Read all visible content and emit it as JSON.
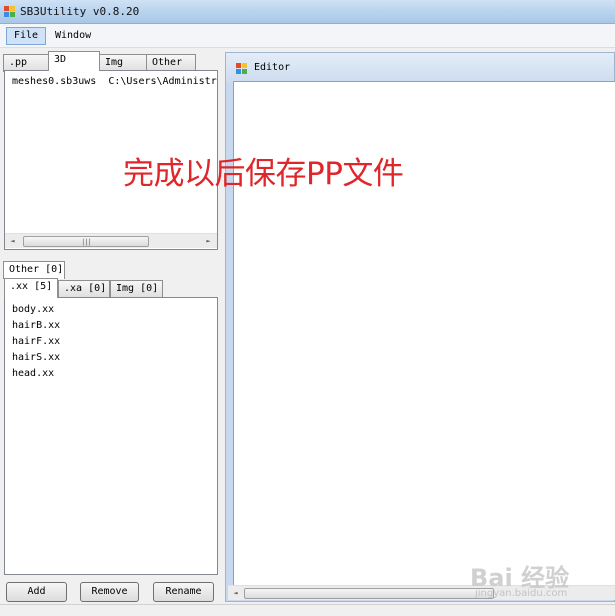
{
  "window": {
    "title": "SB3Utility v0.8.20"
  },
  "menu": {
    "file": "File",
    "window": "Window"
  },
  "top_tabs": [
    ".pp",
    "3D",
    "Img",
    "Other"
  ],
  "file_list": {
    "name": "meshes0.sb3uws",
    "path": "C:\\Users\\Administr"
  },
  "scrollbar": {
    "left_arrow": "◄",
    "right_arrow": "►",
    "grip": "|||"
  },
  "mid_tab": "Other [0]",
  "bottom_tabs": [
    ".xx [5]",
    ".xa [0]",
    "Img [0]"
  ],
  "xx_files": [
    "body.xx",
    "hairB.xx",
    "hairF.xx",
    "hairS.xx",
    "head.xx"
  ],
  "buttons": {
    "add": "Add",
    "remove": "Remove",
    "rename": "Rename"
  },
  "editor": {
    "title": "Editor"
  },
  "overlay": {
    "text": "完成以后保存PP文件"
  },
  "watermark": {
    "logo": "Bai 经验",
    "url": "jingyan.baidu.com"
  },
  "colors": {
    "overlay_text": "#e0262a",
    "titlebar": "#b9d3ee"
  }
}
